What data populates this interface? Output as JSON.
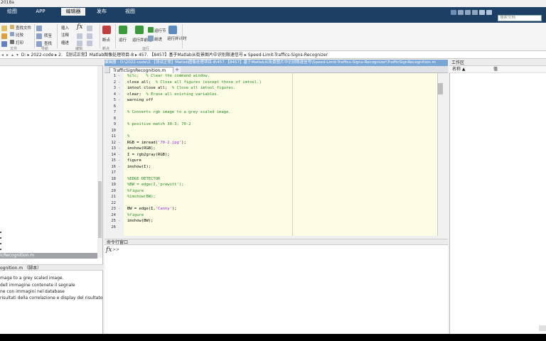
{
  "window": {
    "title": "2018a"
  },
  "tabs": [
    {
      "label": "绘图",
      "active": false
    },
    {
      "label": "APP",
      "active": false
    },
    {
      "label": "编辑器",
      "active": true
    },
    {
      "label": "发布",
      "active": false
    },
    {
      "label": "视图",
      "active": false
    }
  ],
  "search": {
    "placeholder": "搜索文档"
  },
  "ribbon": {
    "find_files": "查找文件",
    "compare": "比较",
    "print": "打印",
    "insert": "插入",
    "comment": "注释",
    "indent": "缩进",
    "go_to": "转至",
    "find": "查找",
    "breakpoints": "断点",
    "run": "运行",
    "run_and_advance": "运行并前进",
    "run_section": "运行节",
    "advance": "前进",
    "run_and_time": "运行并计时",
    "fx": "fx",
    "group_labels": [
      "文件",
      "导航",
      "编辑",
      "断点",
      "运行"
    ]
  },
  "path": {
    "segments": [
      "D:",
      "2022-code",
      "2. 【测试正常】Matlab图像处理项目-8",
      "457. 【8457】基于Matlab从街景图片中识别限速信号",
      "Speed-Limit-Traffics-Signs-Recognizer"
    ]
  },
  "left_panel": {
    "selected_file": "icRecognition.m",
    "details_title": "ognition.m （脚本）",
    "details_lines": [
      "mage to a grey scaled image.",
      "dell immagine contenete il segnale",
      "ne con immagini nel database",
      "risultati della correlazione e display del risultato"
    ]
  },
  "editor": {
    "title": "编辑器 - D:\\2022-code\\2.【测试正常】Matlab图像处理项目-8\\457.【8457】基于Matlab从街景图片中识别限速信号\\Speed-Limit-Traffics-Signs-Recognizer\\TrafficSignRecognition.m",
    "tab_label": "TrafficSignRecognition.m",
    "plus_label": "+",
    "lines": [
      {
        "n": "1",
        "mark": "-",
        "code": "",
        "comment": "%clc;   % Clear the command window."
      },
      {
        "n": "2",
        "mark": "-",
        "code": "close all;  ",
        "comment": "% Close all figures (except those of imtool.)"
      },
      {
        "n": "3",
        "mark": "-",
        "code": "imtool close all;  ",
        "comment": "% Close all imtool figures."
      },
      {
        "n": "4",
        "mark": "-",
        "code": "clear;  ",
        "comment": "% Erase all existing variables."
      },
      {
        "n": "5",
        "mark": "-",
        "code": "warning off",
        "comment": ""
      },
      {
        "n": "6",
        "mark": "",
        "code": "",
        "comment": ""
      },
      {
        "n": "7",
        "mark": "",
        "code": "",
        "comment": "% Converts rgb image to a grey scaled image."
      },
      {
        "n": "8",
        "mark": "",
        "code": "",
        "comment": ""
      },
      {
        "n": "9",
        "mark": "",
        "code": "",
        "comment": "% positive match 30-3; 70-2"
      },
      {
        "n": "10",
        "mark": "",
        "code": "",
        "comment": ""
      },
      {
        "n": "11",
        "mark": "",
        "code": "",
        "comment": "%"
      },
      {
        "n": "12",
        "mark": "-",
        "code": "RGB = imread(",
        "str": "'70-2.jpg'",
        "tail": ");",
        "comment": ""
      },
      {
        "n": "13",
        "mark": "-",
        "code": "imshow(RGB);",
        "comment": ""
      },
      {
        "n": "14",
        "mark": "-",
        "code": "I = rgb2gray(RGB);",
        "comment": ""
      },
      {
        "n": "15",
        "mark": "-",
        "code": "figure",
        "comment": ""
      },
      {
        "n": "16",
        "mark": "-",
        "code": "imshow(I);",
        "comment": ""
      },
      {
        "n": "17",
        "mark": "",
        "code": "",
        "comment": ""
      },
      {
        "n": "18",
        "mark": "",
        "code": "",
        "comment": "%EDGE DETECTOR"
      },
      {
        "n": "19",
        "mark": "",
        "code": "",
        "comment": "%BW = edge(I,'prewitt');"
      },
      {
        "n": "20",
        "mark": "",
        "code": "",
        "comment": "%figure"
      },
      {
        "n": "21",
        "mark": "",
        "code": "",
        "comment": "%imshow(BW);"
      },
      {
        "n": "22",
        "mark": "",
        "code": "",
        "comment": ""
      },
      {
        "n": "23",
        "mark": "-",
        "code": "BW = edge(I,",
        "str": "'Canny'",
        "tail": ");",
        "comment": ""
      },
      {
        "n": "24",
        "mark": "",
        "code": "",
        "comment": "%figure"
      },
      {
        "n": "25",
        "mark": "-",
        "code": "imshow(BW);",
        "comment": ""
      },
      {
        "n": "26",
        "mark": "",
        "code": "",
        "comment": ""
      }
    ]
  },
  "command_window": {
    "title": "命令行窗口",
    "prompt": "fx",
    "arrows": ">>"
  },
  "workspace": {
    "title": "工作区",
    "col_name": "名称 ▲",
    "col_value": "值"
  },
  "colors": {
    "tabstrip": "#1c3f63",
    "editor_bg": "#fdfde6",
    "comment": "#228b22",
    "string": "#a020f0"
  }
}
